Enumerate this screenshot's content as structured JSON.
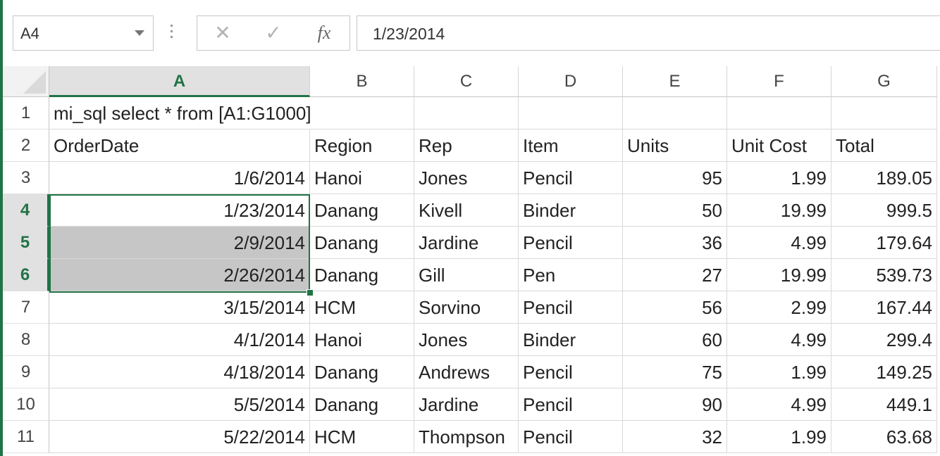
{
  "name_box": {
    "value": "A4"
  },
  "formula_bar": {
    "cancel_icon": "✕",
    "enter_icon": "✓",
    "fx_label": "fx",
    "value": "1/23/2014"
  },
  "columns": [
    "A",
    "B",
    "C",
    "D",
    "E",
    "F",
    "G"
  ],
  "active_column": "A",
  "active_cell": "A4",
  "selected_range": "A4:A6",
  "rows": [
    {
      "num": "1",
      "cells": [
        "mi_sql select * from [A1:G1000]",
        "",
        "",
        "",
        "",
        "",
        ""
      ]
    },
    {
      "num": "2",
      "cells": [
        "OrderDate",
        "Region",
        "Rep",
        "Item",
        "Units",
        "Unit Cost",
        "Total"
      ]
    },
    {
      "num": "3",
      "cells": [
        "1/6/2014",
        "Hanoi",
        "Jones",
        "Pencil",
        "95",
        "1.99",
        "189.05"
      ]
    },
    {
      "num": "4",
      "cells": [
        "1/23/2014",
        "Danang",
        "Kivell",
        "Binder",
        "50",
        "19.99",
        "999.5"
      ]
    },
    {
      "num": "5",
      "cells": [
        "2/9/2014",
        "Danang",
        "Jardine",
        "Pencil",
        "36",
        "4.99",
        "179.64"
      ]
    },
    {
      "num": "6",
      "cells": [
        "2/26/2014",
        "Danang",
        "Gill",
        "Pen",
        "27",
        "19.99",
        "539.73"
      ]
    },
    {
      "num": "7",
      "cells": [
        "3/15/2014",
        "HCM",
        "Sorvino",
        "Pencil",
        "56",
        "2.99",
        "167.44"
      ]
    },
    {
      "num": "8",
      "cells": [
        "4/1/2014",
        "Hanoi",
        "Jones",
        "Binder",
        "60",
        "4.99",
        "299.4"
      ]
    },
    {
      "num": "9",
      "cells": [
        "4/18/2014",
        "Danang",
        "Andrews",
        "Pencil",
        "75",
        "1.99",
        "149.25"
      ]
    },
    {
      "num": "10",
      "cells": [
        "5/5/2014",
        "Danang",
        "Jardine",
        "Pencil",
        "90",
        "4.99",
        "449.1"
      ]
    },
    {
      "num": "11",
      "cells": [
        "5/22/2014",
        "HCM",
        "Thompson",
        "Pencil",
        "32",
        "1.99",
        "63.68"
      ]
    }
  ],
  "colors": {
    "accent": "#217346",
    "selection_fill": "#c6c6c6",
    "header_active": "#e1e1e1"
  }
}
